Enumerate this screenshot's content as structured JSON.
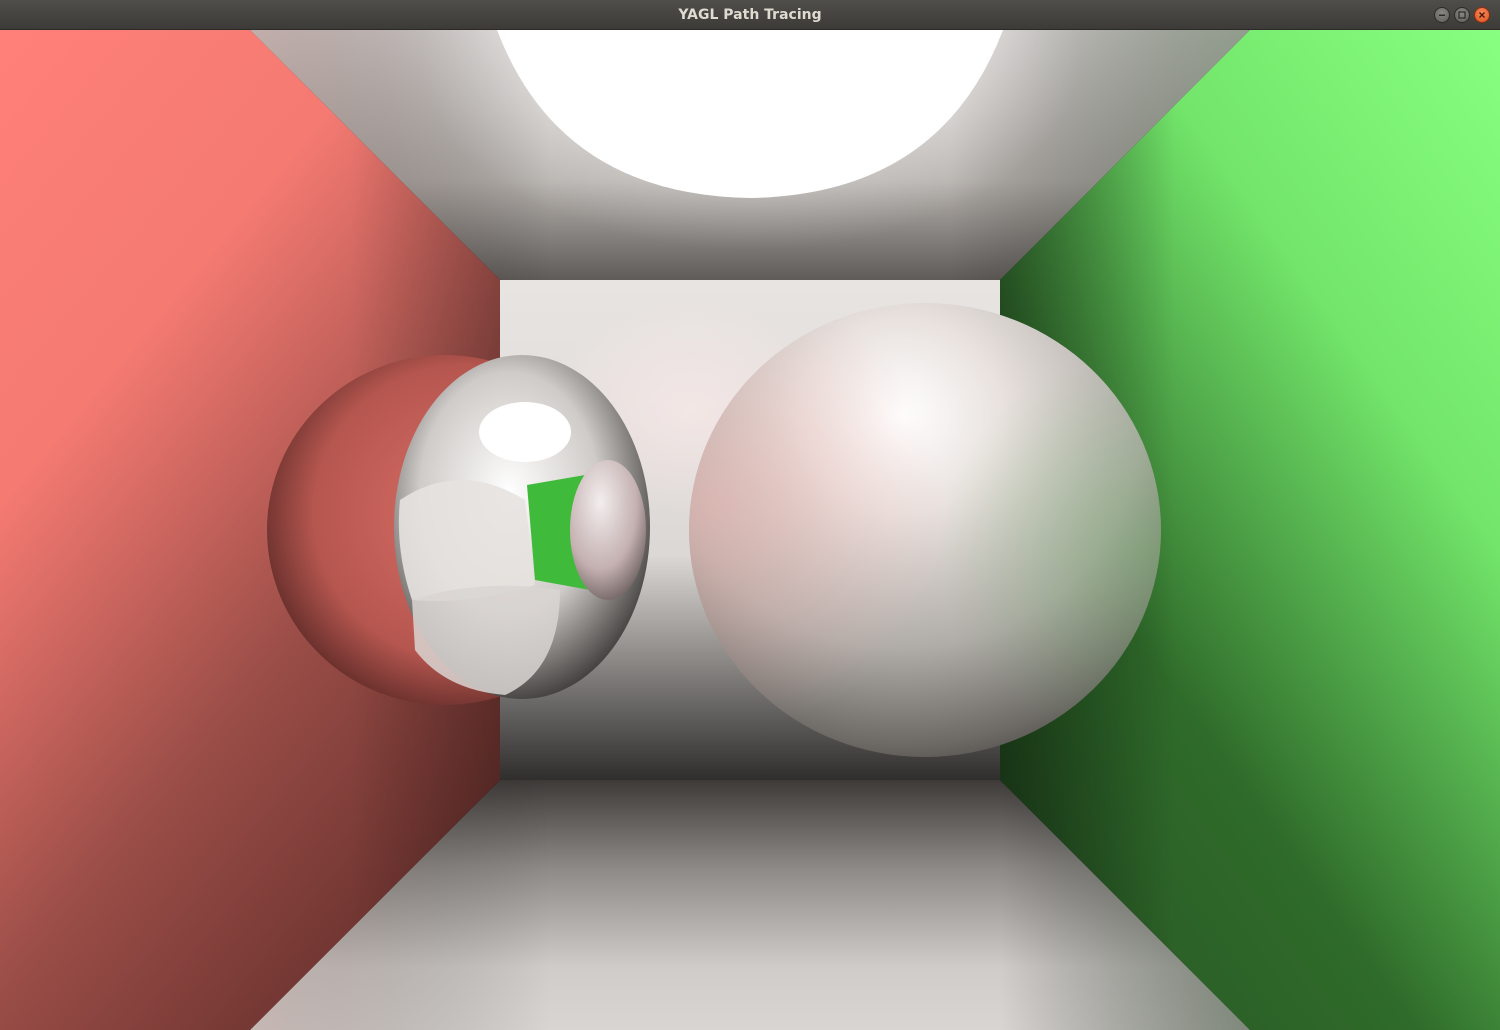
{
  "window": {
    "title": "YAGL Path Tracing",
    "controls": [
      "minimize-icon",
      "maximize-icon",
      "close-icon"
    ]
  },
  "scene": {
    "colors": {
      "left_wall": "#f47a72",
      "right_wall": "#7ff579",
      "back_wall": "#e4e0dd",
      "ceiling": "#d9d4d2",
      "floor": "#cfccc9",
      "light": "#ffffff",
      "accent_close": "#e95420"
    }
  }
}
